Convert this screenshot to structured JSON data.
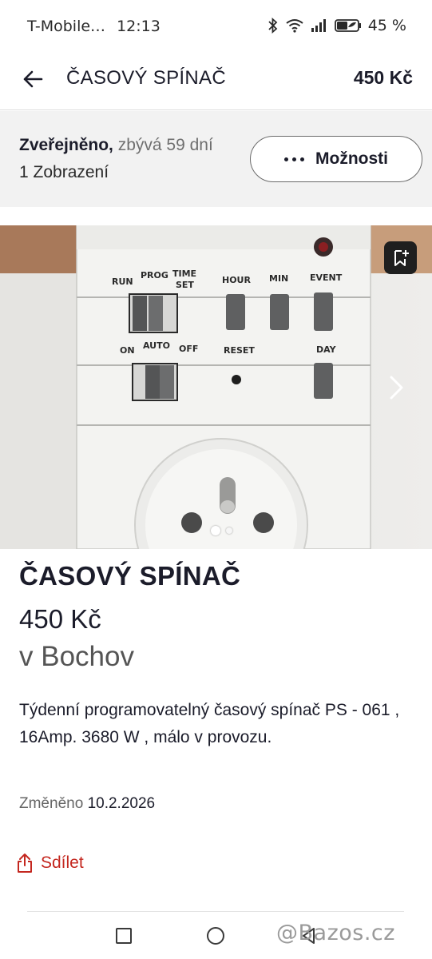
{
  "status_bar": {
    "carrier": "T-Mobile…",
    "time": "12:13",
    "battery": "45 %",
    "icons": [
      "bluetooth-icon",
      "wifi-icon",
      "signal-icon",
      "battery-icon"
    ]
  },
  "app_bar": {
    "title": "ČASOVÝ SPÍNAČ",
    "price": "450 Kč"
  },
  "info_bar": {
    "published": "Zveřejněno,",
    "remaining": "zbývá 59 dní",
    "views": "1 Zobrazení",
    "options_label": "Možnosti"
  },
  "gallery": {
    "image_count": 2,
    "active_index": 0,
    "photo_labels": {
      "run": "RUN",
      "prog": "PROG",
      "time": "TIME",
      "set": "SET",
      "hour": "HOUR",
      "min": "MIN",
      "event": "EVENT",
      "on": "ON",
      "auto": "AUTO",
      "off": "OFF",
      "reset": "RESET",
      "day": "DAY"
    }
  },
  "listing": {
    "title": "ČASOVÝ SPÍNAČ",
    "price": "450 Kč",
    "location": "v Bochov",
    "description": "Týdenní programovatelný časový spínač PS - 061 , 16Amp. 3680 W , málo v provozu.",
    "changed_label": "Změněno",
    "changed_date": "10.2.2026",
    "share_label": "Sdílet"
  },
  "watermark": "@Bazos.cz",
  "colors": {
    "accent": "#c4271f",
    "text": "#1b1c2a",
    "info_bg": "#f2f2f2"
  }
}
